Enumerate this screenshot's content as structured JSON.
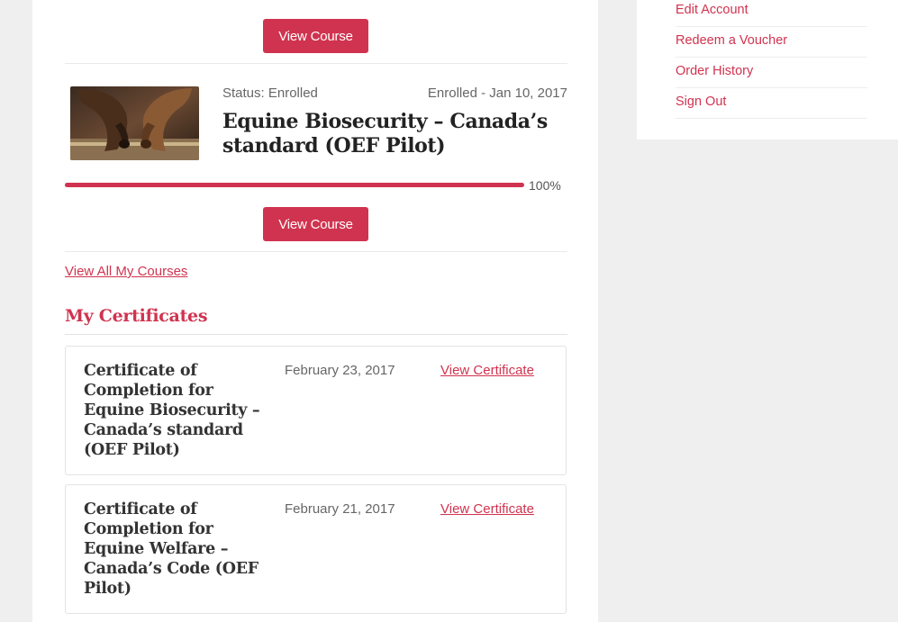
{
  "courses": [
    {
      "view_label": "View Course"
    },
    {
      "status": "Status: Enrolled",
      "enrolled": "Enrolled - Jan 10, 2017",
      "title": "Equine Biosecurity – Canada’s standard (OEF Pilot)",
      "progress_percent": 100,
      "progress_label": "100%",
      "view_label": "View Course",
      "thumbnail_icon": "horses-photo"
    }
  ],
  "view_all": "View All My Courses",
  "certificates": {
    "heading": "My Certificates",
    "items": [
      {
        "name": "Certificate of Completion for Equine Biosecurity – Canada’s standard (OEF Pilot)",
        "date": "February 23, 2017",
        "link": "View Certificate"
      },
      {
        "name": "Certificate of Completion for Equine Welfare – Canada’s Code (OEF Pilot)",
        "date": "February 21, 2017",
        "link": "View Certificate"
      }
    ]
  },
  "sidebar": {
    "items": [
      {
        "label": "Edit Account"
      },
      {
        "label": "Redeem a Voucher"
      },
      {
        "label": "Order History"
      },
      {
        "label": "Sign Out"
      }
    ]
  },
  "colors": {
    "accent": "#d0334f",
    "background": "#efefef"
  }
}
